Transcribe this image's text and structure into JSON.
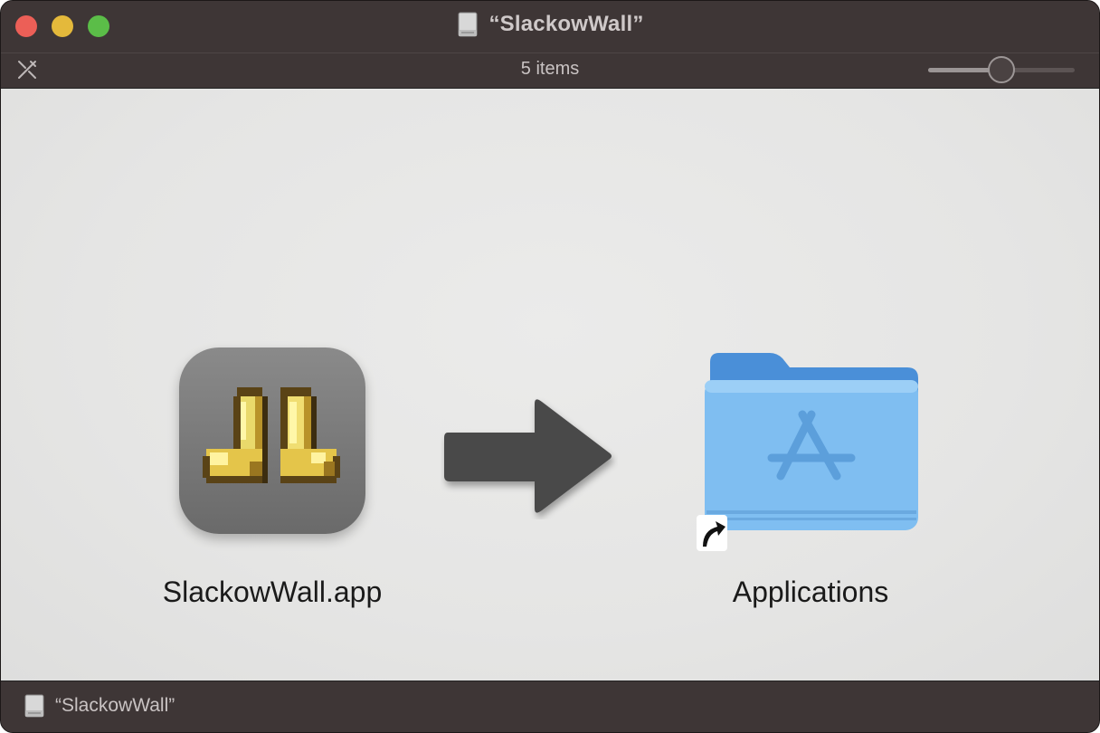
{
  "window": {
    "title": "“SlackowWall”"
  },
  "toolbar": {
    "items_count": "5 items",
    "icon_size_slider": {
      "value": 0.5
    }
  },
  "items": [
    {
      "label": "SlackowWall.app",
      "icon": "slackowwall-app-icon"
    },
    {
      "label": "Applications",
      "icon": "applications-folder-icon"
    }
  ],
  "statusbar": {
    "path": "“SlackowWall”"
  },
  "colors": {
    "close": "#ec5f57",
    "minimize": "#e4b93b",
    "zoom": "#5bbd48",
    "chrome": "#3e3636",
    "folder_blue": "#7ab8ee"
  }
}
